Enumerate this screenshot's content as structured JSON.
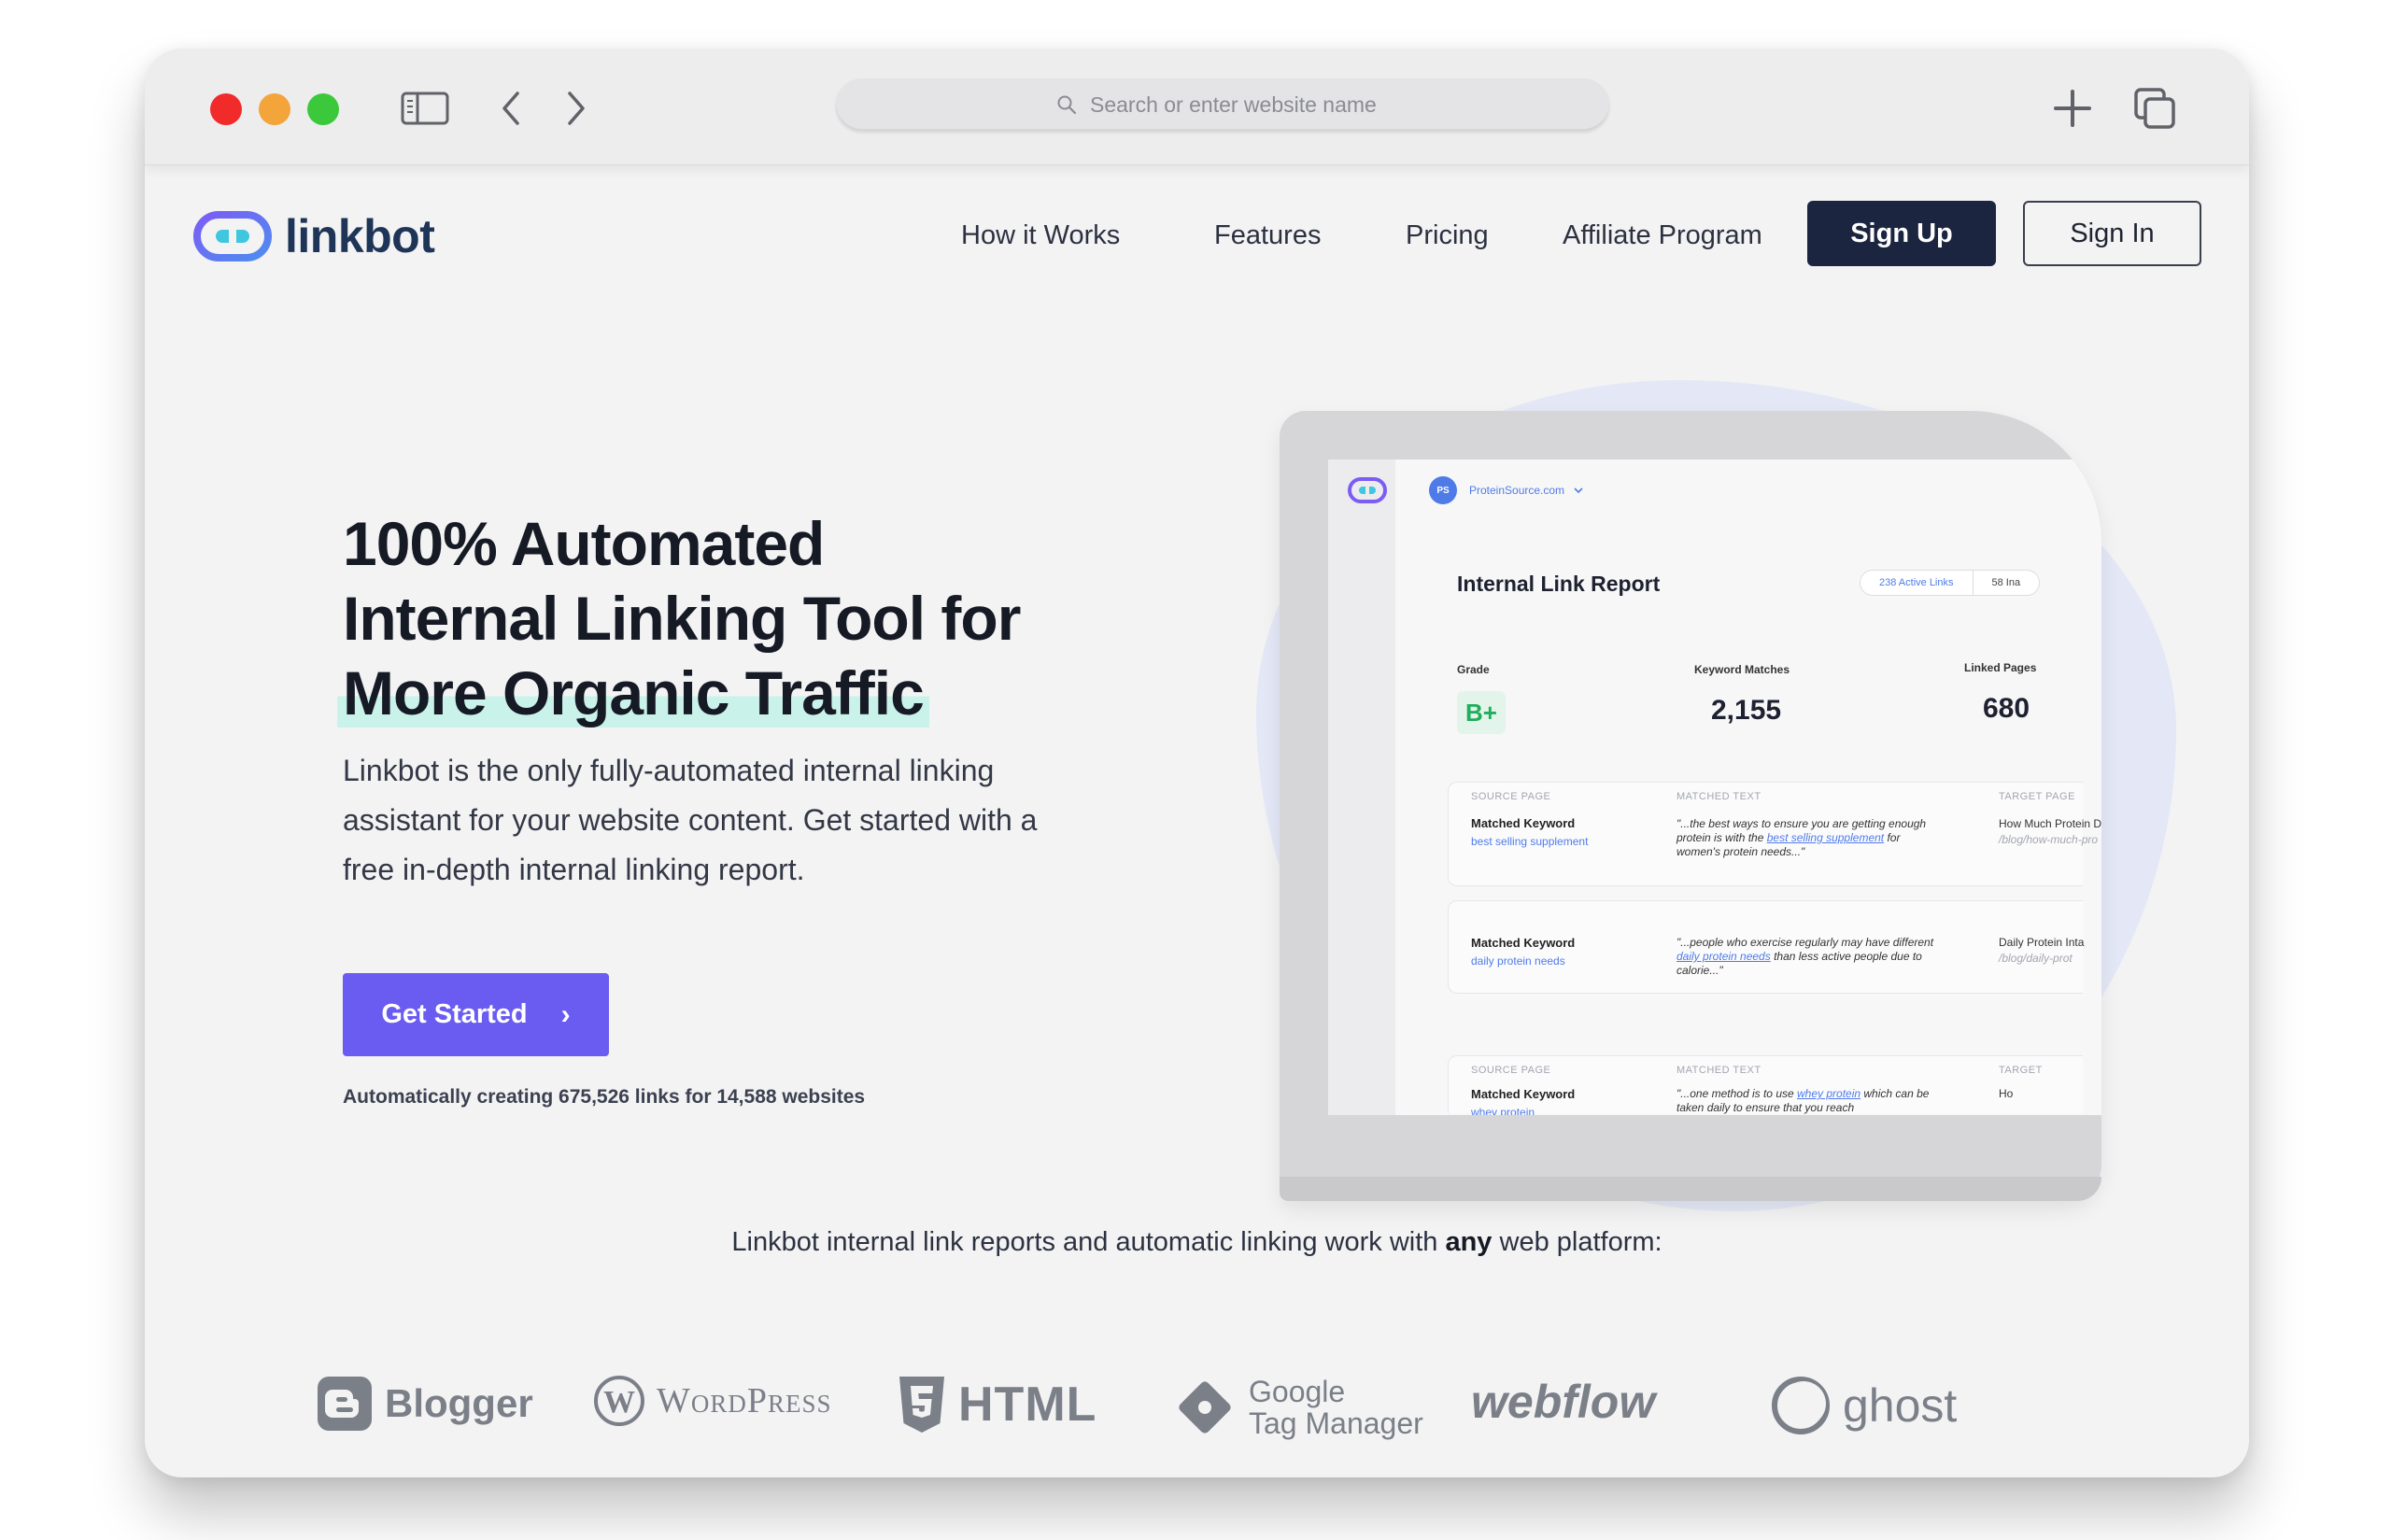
{
  "browser": {
    "address_placeholder": "Search or enter website name"
  },
  "site": {
    "logo_text": "linkbot",
    "nav": [
      "How it Works",
      "Features",
      "Pricing",
      "Affiliate Program"
    ],
    "signup_label": "Sign Up",
    "signin_label": "Sign In"
  },
  "hero": {
    "title_line1": "100% Automated",
    "title_line2": "Internal Linking Tool for",
    "title_line3": "More Organic Traffic",
    "description": "Linkbot is the only fully-automated internal linking assistant for your website content. Get started with a free in-depth internal linking report.",
    "cta_label": "Get Started",
    "cta_arrow": "›",
    "stats": "Automatically creating 675,526 links for 14,588 websites"
  },
  "mockup": {
    "ps_initials": "PS",
    "site_name": "ProteinSource.com",
    "report_title": "Internal Link Report",
    "pill_active": "238 Active Links",
    "pill_other": "58 Ina",
    "grade_label": "Grade",
    "grade_value": "B+",
    "kw_label": "Keyword Matches",
    "kw_value": "2,155",
    "linked_label": "Linked Pages",
    "linked_value": "680",
    "col_source": "SOURCE PAGE",
    "col_matched": "MATCHED TEXT",
    "col_target": "TARGET PAGE",
    "col_target_short": "TARGET",
    "rows": [
      {
        "kw_label": "Matched Keyword",
        "kw": "best selling supplement",
        "quote_pre": "\"...the best ways to ensure you are getting enough protein is with the ",
        "quote_link": "best selling supplement",
        "quote_post": " for women's protein needs...\"",
        "target_title": "How Much Protein D",
        "target_url": "/blog/how-much-pro"
      },
      {
        "kw_label": "Matched Keyword",
        "kw": "daily protein needs",
        "quote_pre": "\"...people who exercise regularly may have different ",
        "quote_link": "daily protein needs",
        "quote_post": " than less active people due to calorie...\"",
        "target_title": "Daily Protein Inta",
        "target_url": "/blog/daily-prot"
      },
      {
        "kw_label": "Matched Keyword",
        "kw": "whey protein",
        "quote_pre": "\"...one method is to use ",
        "quote_link": "whey protein",
        "quote_post": " which can be taken daily to ensure that you reach",
        "target_title": "Ho",
        "target_url": ""
      }
    ]
  },
  "platforms": {
    "note_pre": "Linkbot internal link reports and automatic linking work with ",
    "note_bold": "any",
    "note_post": " web platform:",
    "blogger": "Blogger",
    "wordpress": "WordPress",
    "html": "HTML",
    "gtm_line1": "Google",
    "gtm_line2": "Tag Manager",
    "webflow": "webflow",
    "ghost": "ghost"
  },
  "colors": {
    "primary_button": "#6a5cf0",
    "signup_bg": "#1c2540",
    "logo_color": "#1f3558",
    "highlight": "#c9f3ea"
  }
}
